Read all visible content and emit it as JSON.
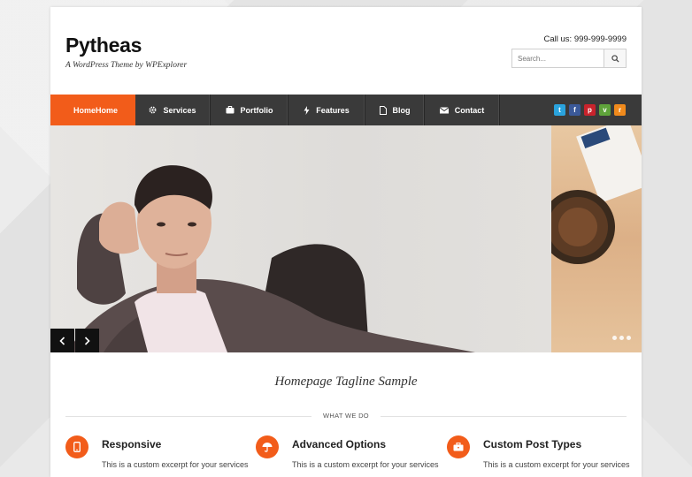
{
  "site": {
    "title": "Pytheas",
    "tagline": "A WordPress Theme by WPExplorer",
    "call_us": "Call us: 999-999-9999",
    "search_placeholder": "Search..."
  },
  "nav": {
    "items": [
      {
        "label": "HomeHome",
        "icon": "home-icon"
      },
      {
        "label": "Services",
        "icon": "gear-icon"
      },
      {
        "label": "Portfolio",
        "icon": "briefcase-icon"
      },
      {
        "label": "Features",
        "icon": "bolt-icon"
      },
      {
        "label": "Blog",
        "icon": "document-icon"
      },
      {
        "label": "Contact",
        "icon": "envelope-icon"
      }
    ],
    "active_index": 0,
    "social": [
      {
        "name": "twitter-icon",
        "glyph": "t",
        "color": "#2aa3dd"
      },
      {
        "name": "facebook-icon",
        "glyph": "f",
        "color": "#3b5998"
      },
      {
        "name": "pinterest-icon",
        "glyph": "p",
        "color": "#c8232c"
      },
      {
        "name": "leaf-icon",
        "glyph": "v",
        "color": "#5fa33b"
      },
      {
        "name": "rss-icon",
        "glyph": "r",
        "color": "#f08a1c"
      }
    ]
  },
  "slider": {
    "prev_icon": "chevron-left-icon",
    "next_icon": "chevron-right-icon",
    "dot_count": 3
  },
  "home": {
    "tagline": "Homepage Tagline Sample",
    "section_label": "WHAT WE DO"
  },
  "services": [
    {
      "title": "Responsive",
      "excerpt": "This is a custom excerpt for your services",
      "icon": "mobile-icon"
    },
    {
      "title": "Advanced Options",
      "excerpt": "This is a custom excerpt for your services",
      "icon": "umbrella-icon"
    },
    {
      "title": "Custom Post Types",
      "excerpt": "This is a custom excerpt for your services",
      "icon": "briefcase-icon"
    }
  ],
  "colors": {
    "accent": "#f25c1a",
    "nav_bg": "#3a3a3a"
  }
}
